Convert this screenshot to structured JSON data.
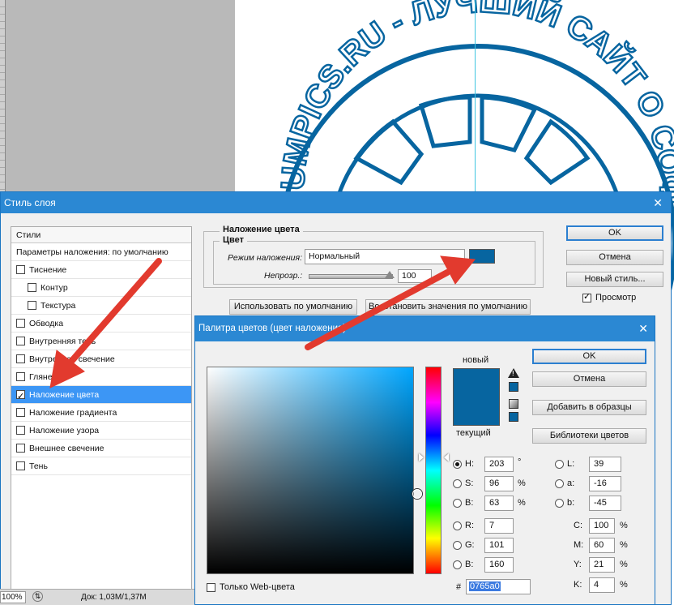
{
  "stamp": {
    "text": "UMPICS.RU - ЛУЧШИЙ САЙТ О СОФТ",
    "color": "#0765a0"
  },
  "layer_style": {
    "title": "Стиль слоя",
    "styles_header": "Стили",
    "styles": [
      {
        "label": "Параметры наложения: по умолчанию",
        "checkbox": false,
        "checked": false,
        "indent": false,
        "selected": false
      },
      {
        "label": "Тиснение",
        "checkbox": true,
        "checked": false,
        "indent": false,
        "selected": false
      },
      {
        "label": "Контур",
        "checkbox": true,
        "checked": false,
        "indent": true,
        "selected": false
      },
      {
        "label": "Текстура",
        "checkbox": true,
        "checked": false,
        "indent": true,
        "selected": false
      },
      {
        "label": "Обводка",
        "checkbox": true,
        "checked": false,
        "indent": false,
        "selected": false
      },
      {
        "label": "Внутренняя тень",
        "checkbox": true,
        "checked": false,
        "indent": false,
        "selected": false
      },
      {
        "label": "Внутреннее свечение",
        "checkbox": true,
        "checked": false,
        "indent": false,
        "selected": false
      },
      {
        "label": "Глянец",
        "checkbox": true,
        "checked": false,
        "indent": false,
        "selected": false
      },
      {
        "label": "Наложение цвета",
        "checkbox": true,
        "checked": true,
        "indent": false,
        "selected": true
      },
      {
        "label": "Наложение градиента",
        "checkbox": true,
        "checked": false,
        "indent": false,
        "selected": false
      },
      {
        "label": "Наложение узора",
        "checkbox": true,
        "checked": false,
        "indent": false,
        "selected": false
      },
      {
        "label": "Внешнее свечение",
        "checkbox": true,
        "checked": false,
        "indent": false,
        "selected": false
      },
      {
        "label": "Тень",
        "checkbox": true,
        "checked": false,
        "indent": false,
        "selected": false
      }
    ],
    "group_title": "Наложение цвета",
    "subgroup_title": "Цвет",
    "blend_mode_label": "Режим наложения:",
    "blend_mode_value": "Нормальный",
    "opacity_label": "Непрозр.:",
    "opacity_value": "100",
    "opacity_unit": "%",
    "use_default_button": "Использовать по умолчанию",
    "restore_default_button": "Восстановить значения по умолчанию",
    "ok_button": "OK",
    "cancel_button": "Отмена",
    "new_style_button": "Новый стиль...",
    "preview_label": "Просмотр",
    "preview_checked": true,
    "overlay_color": "#0765a0"
  },
  "color_picker": {
    "title": "Палитра цветов (цвет наложения)",
    "new_label": "новый",
    "current_label": "текущий",
    "ok_button": "OK",
    "cancel_button": "Отмена",
    "add_swatch_button": "Добавить в образцы",
    "libraries_button": "Библиотеки цветов",
    "hsb": {
      "h": "203",
      "s": "96",
      "b": "63",
      "h_unit": "°",
      "s_unit": "%",
      "b_unit": "%",
      "h_label": "H:",
      "s_label": "S:",
      "b_label": "B:"
    },
    "rgb": {
      "r": "7",
      "g": "101",
      "b": "160",
      "r_label": "R:",
      "g_label": "G:",
      "b_label": "B:"
    },
    "lab": {
      "l": "39",
      "a": "-16",
      "b": "-45",
      "l_label": "L:",
      "a_label": "a:",
      "b_label": "b:"
    },
    "cmyk": {
      "c": "100",
      "m": "60",
      "y": "21",
      "k": "4",
      "c_label": "C:",
      "m_label": "M:",
      "y_label": "Y:",
      "k_label": "K:",
      "unit": "%"
    },
    "hex_label": "#",
    "hex_value": "0765a0",
    "web_only_label": "Только Web-цвета",
    "selected_mode": "H",
    "new_color": "#0765a0",
    "current_color": "#0765a0"
  },
  "status_bar": {
    "zoom": "100%",
    "doc_info": "Док: 1,03M/1,37M"
  }
}
